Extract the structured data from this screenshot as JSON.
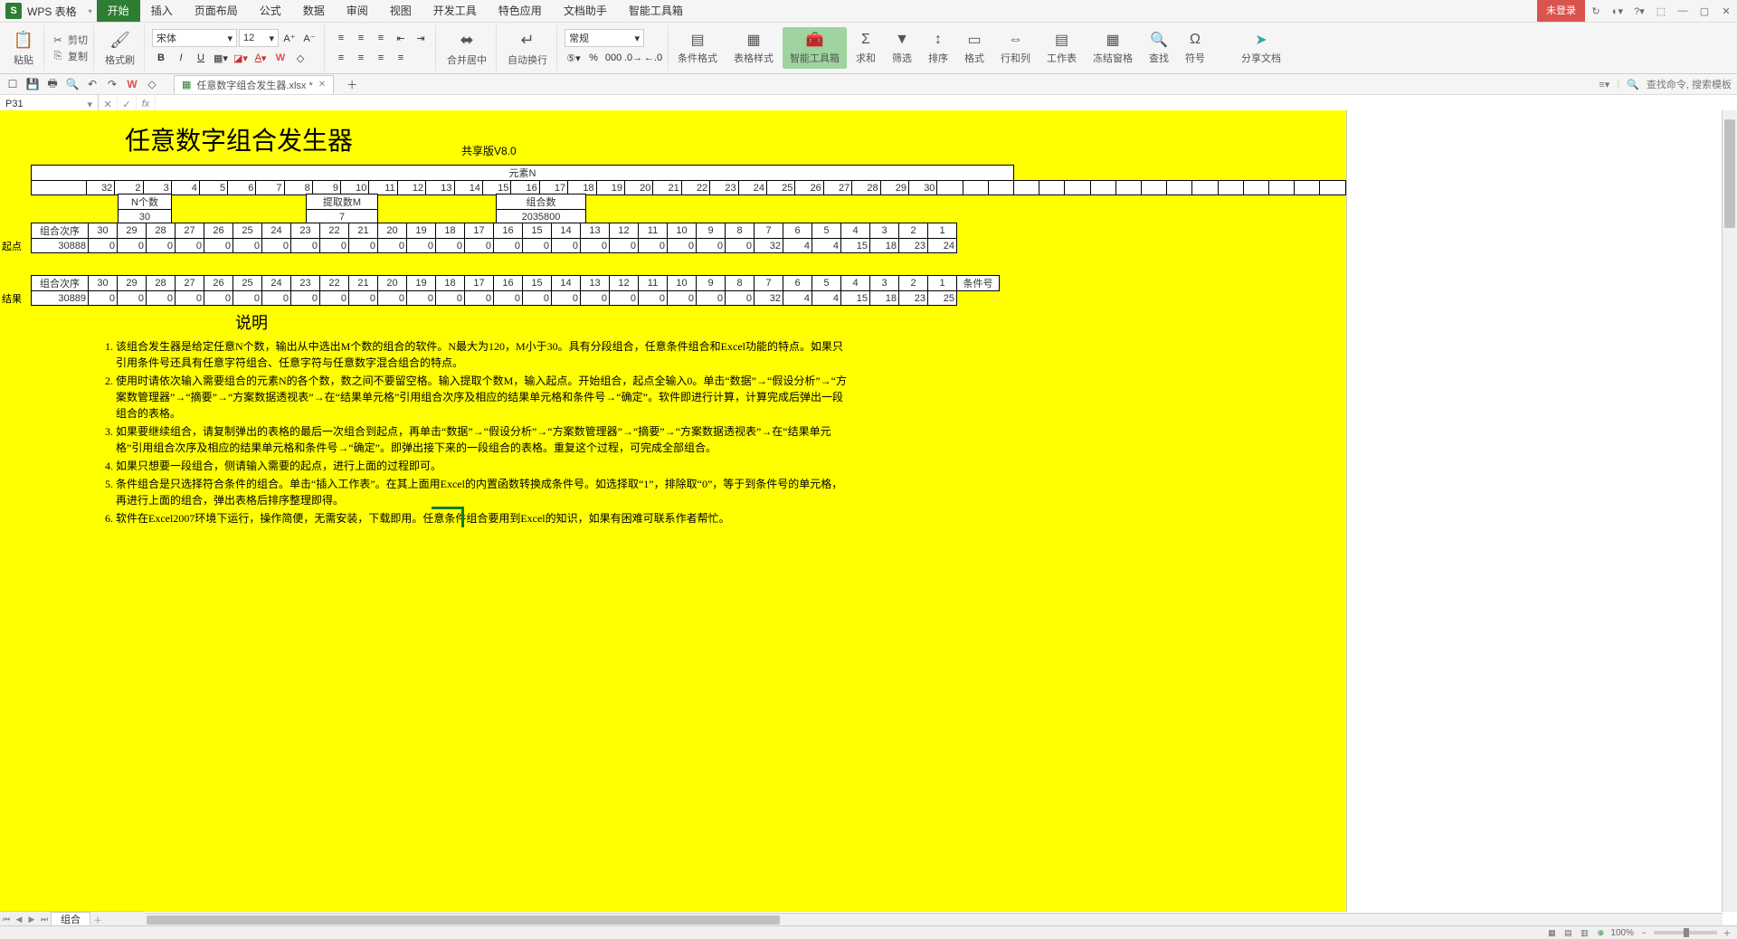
{
  "app": {
    "logo": "S",
    "name": "WPS 表格",
    "login": "未登录"
  },
  "menu": {
    "items": [
      "开始",
      "插入",
      "页面布局",
      "公式",
      "数据",
      "审阅",
      "视图",
      "开发工具",
      "特色应用",
      "文档助手",
      "智能工具箱"
    ],
    "active": 0
  },
  "ribbon": {
    "paste": "粘贴",
    "cut": "剪切",
    "copy": "复制",
    "format_painter": "格式刷",
    "font_name": "宋体",
    "font_size": "12",
    "merge": "合并居中",
    "wrap": "自动换行",
    "num_format": "常规",
    "cond": "条件格式",
    "tbl": "表格样式",
    "smart": "智能工具箱",
    "sum": "求和",
    "filter": "筛选",
    "sort": "排序",
    "format": "格式",
    "rowcol": "行和列",
    "sheet": "工作表",
    "freeze": "冻结窗格",
    "find": "查找",
    "symbol": "符号",
    "share": "分享文档"
  },
  "qat": {
    "doc_name": "任意数字组合发生器.xlsx *",
    "search": "查找命令, 搜索模板"
  },
  "cell_ref": "P31",
  "sheet": {
    "name": "组合"
  },
  "content": {
    "title": "任意数字组合发生器",
    "version": "共享版V8.0",
    "hdr_elements": "元素N",
    "elements": [
      "32",
      "2",
      "3",
      "4",
      "5",
      "6",
      "7",
      "8",
      "9",
      "10",
      "11",
      "12",
      "13",
      "14",
      "15",
      "16",
      "17",
      "18",
      "19",
      "20",
      "21",
      "22",
      "23",
      "24",
      "25",
      "26",
      "27",
      "28",
      "29",
      "30"
    ],
    "n_label": "N个数",
    "n_val": "30",
    "m_label": "提取数M",
    "m_val": "7",
    "comb_label": "组合数",
    "comb_val": "2035800",
    "seq_label": "组合次序",
    "start_label": "起点",
    "result_label": "结果",
    "cond_label": "条件号",
    "seq1": [
      "30",
      "29",
      "28",
      "27",
      "26",
      "25",
      "24",
      "23",
      "22",
      "21",
      "20",
      "19",
      "18",
      "17",
      "16",
      "15",
      "14",
      "13",
      "12",
      "11",
      "10",
      "9",
      "8",
      "7",
      "6",
      "5",
      "4",
      "3",
      "2",
      "1"
    ],
    "start_num": "30888",
    "start_row": [
      "0",
      "0",
      "0",
      "0",
      "0",
      "0",
      "0",
      "0",
      "0",
      "0",
      "0",
      "0",
      "0",
      "0",
      "0",
      "0",
      "0",
      "0",
      "0",
      "0",
      "0",
      "0",
      "0",
      "32",
      "4",
      "4",
      "15",
      "18",
      "23",
      "24"
    ],
    "seq2": [
      "30",
      "29",
      "28",
      "27",
      "26",
      "25",
      "24",
      "23",
      "22",
      "21",
      "20",
      "19",
      "18",
      "17",
      "16",
      "15",
      "14",
      "13",
      "12",
      "11",
      "10",
      "9",
      "8",
      "7",
      "6",
      "5",
      "4",
      "3",
      "2",
      "1"
    ],
    "res_num": "30889",
    "res_row": [
      "0",
      "0",
      "0",
      "0",
      "0",
      "0",
      "0",
      "0",
      "0",
      "0",
      "0",
      "0",
      "0",
      "0",
      "0",
      "0",
      "0",
      "0",
      "0",
      "0",
      "0",
      "0",
      "0",
      "32",
      "4",
      "4",
      "15",
      "18",
      "23",
      "25"
    ],
    "desc_title": "说明",
    "desc": {
      "1": "该组合发生器是给定任意N个数，输出从中选出M个数的组合的软件。N最大为120，M小于30。具有分段组合，任意条件组合和Excel功能的特点。如果只引用条件号还具有任意字符组合、任意字符与任意数字混合组合的特点。",
      "2": "使用时请依次输入需要组合的元素N的各个数，数之间不要留空格。输入提取个数M，输入起点。开始组合，起点全输入0。单击“数据”→“假设分析”→“方案数管理器”→“摘要”→“方案数据透视表”→在“结果单元格”引用组合次序及相应的结果单元格和条件号→“确定”。软件即进行计算，计算完成后弹出一段组合的表格。",
      "3": "如果要继续组合，请复制弹出的表格的最后一次组合到起点，再单击“数据”→“假设分析”→“方案数管理器”→“摘要”→“方案数据透视表”→在“结果单元格”引用组合次序及相应的结果单元格和条件号→“确定”。即弹出接下来的一段组合的表格。重复这个过程，可完成全部组合。",
      "4": "如果只想要一段组合，侧请输入需要的起点，进行上面的过程即可。",
      "5": "条件组合是只选择符合条件的组合。单击“插入工作表”。在其上面用Excel的内置函数转换成条件号。如选择取“1”，排除取“0”，等于到条件号的单元格，再进行上面的组合，弹出表格后排序整理即得。",
      "6": "软件在Excel2007环境下运行，操作简便，无需安装，下载即用。任意条件组合要用到Excel的知识，如果有困难可联系作者帮忙。"
    }
  },
  "status": {
    "zoom": "100%"
  }
}
